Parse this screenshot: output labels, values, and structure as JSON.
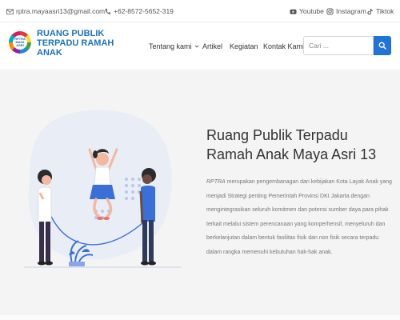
{
  "topbar": {
    "email": "rptra.mayaasri13@gmail.com",
    "phone": "+62-8572-5652-319",
    "social": [
      {
        "label": "Youtube",
        "icon": "youtube-icon"
      },
      {
        "label": "Instagram",
        "icon": "instagram-icon"
      },
      {
        "label": "Tiktok",
        "icon": "tiktok-icon"
      }
    ]
  },
  "header": {
    "logo_text": "RPTRA MAYA ASRI",
    "brand": "RUANG PUBLIK TERPADU RAMAH ANAK",
    "nav": [
      {
        "label": "Tentang kami",
        "has_dropdown": true
      },
      {
        "label": "Artikel"
      },
      {
        "label": "Kegiatan"
      },
      {
        "label": "Kontak Kami"
      }
    ],
    "search": {
      "placeholder": "Cari ...",
      "value": "",
      "button_icon": "search-icon"
    }
  },
  "hero": {
    "title": "Ruang Publik Terpadu Ramah Anak Maya Asri 13",
    "description_abbr": "RPTRA",
    "description": " merupakan pengembanagan dari kebijakan Kota Layak Anak yang menjadi Strategi penting Pemerintah Provinsi DKI Jakarta dengan mengintegrasikan seluruh komitmen dan potensi sumber daya para pihak terkait melalui sistem perencanaan yang komperhensif, menyeluruh dan berkelanjutan dalam bentuk fasilitas fisik dan non fisik secara terpadu dalam rangka memenuhi kebutuhan hak-hak anak."
  },
  "colors": {
    "brand_blue": "#1f73b7",
    "button_blue": "#1f73d9",
    "hero_bg": "#f4f4f4",
    "illustration_blue": "#3b6fd8",
    "skin": "#f2b8a0"
  }
}
